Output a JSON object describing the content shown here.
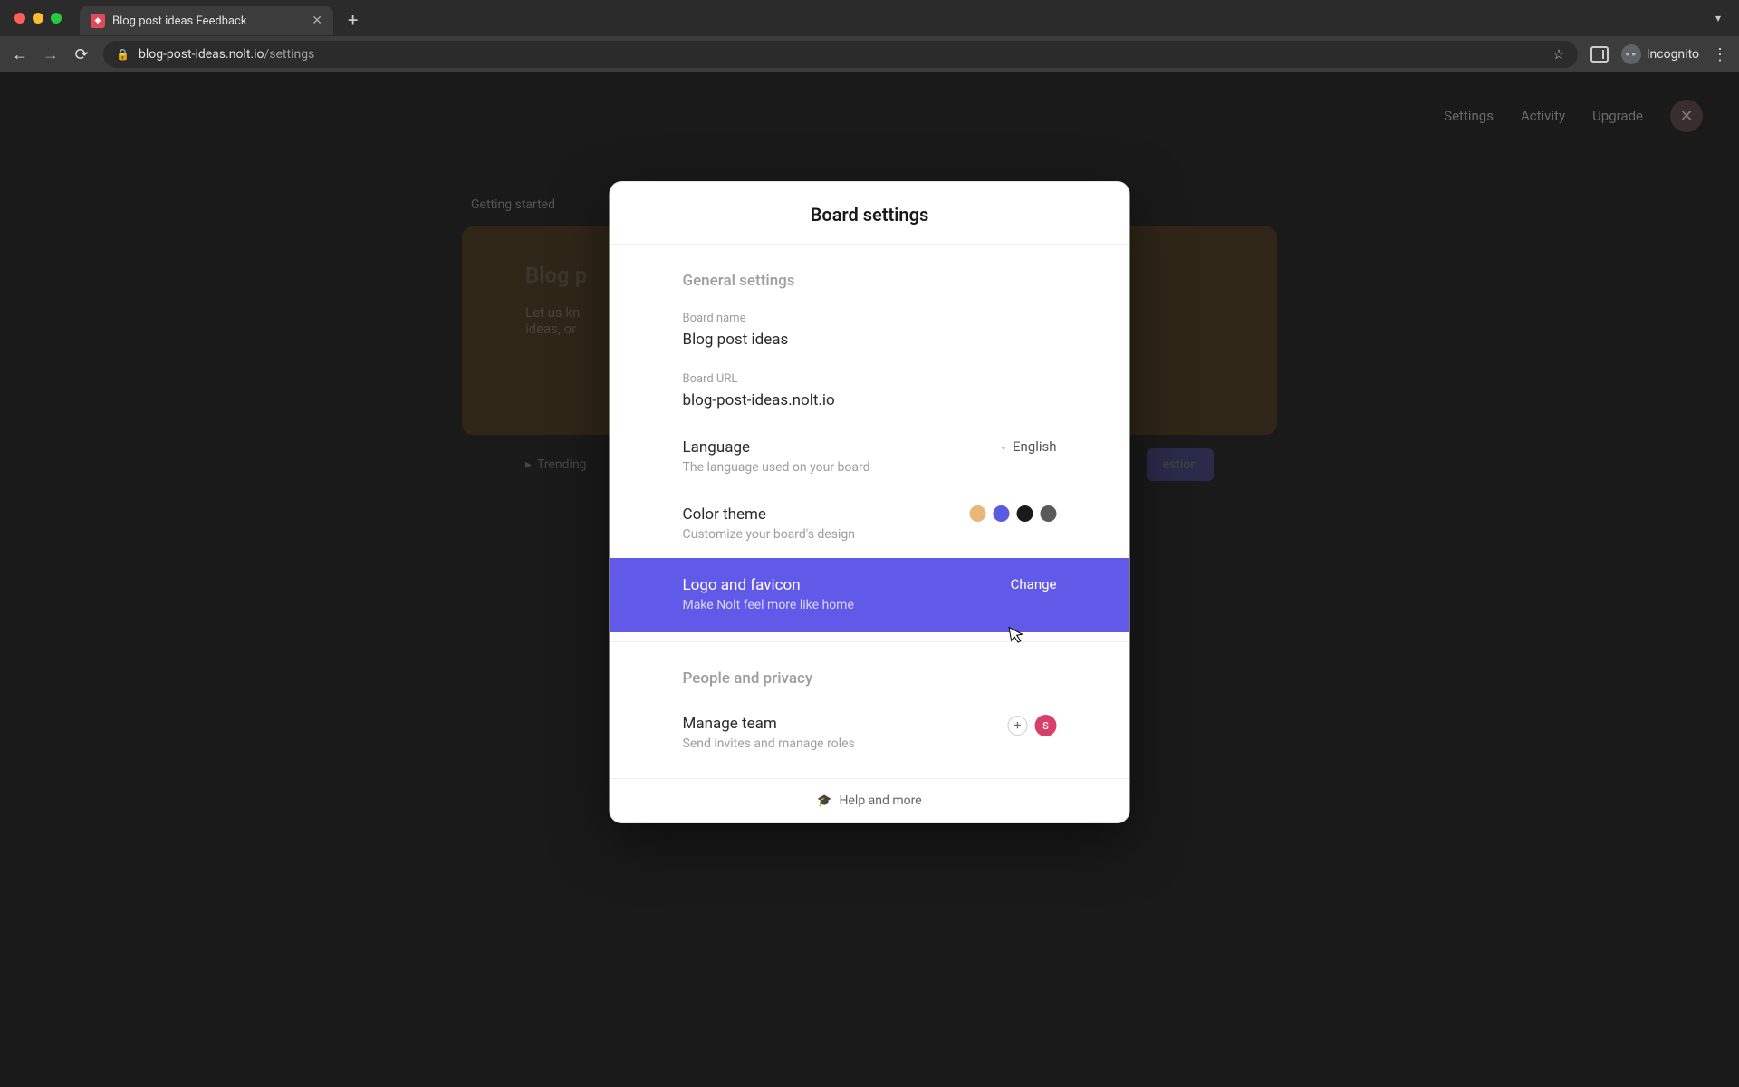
{
  "browser": {
    "tab_title": "Blog post ideas Feedback",
    "url_host": "blog-post-ideas.nolt.io",
    "url_path": "/settings",
    "incognito_label": "Incognito"
  },
  "backdrop": {
    "nav": {
      "settings": "Settings",
      "activity": "Activity",
      "upgrade": "Upgrade"
    },
    "getting_started": "Getting started",
    "card_title": "Blog p",
    "card_line1": "Let us kn",
    "card_line2": "ideas, or",
    "trending": "Trending",
    "suggestion_btn": "estion"
  },
  "modal": {
    "title": "Board settings",
    "general": {
      "section_title": "General settings",
      "board_name_label": "Board name",
      "board_name_value": "Blog post ideas",
      "board_url_label": "Board URL",
      "board_url_value": "blog-post-ideas.nolt.io",
      "language_title": "Language",
      "language_sub": "The language used on your board",
      "language_value": "English",
      "color_title": "Color theme",
      "color_sub": "Customize your board's design",
      "logo_title": "Logo and favicon",
      "logo_sub": "Make Nolt feel more like home",
      "logo_action": "Change"
    },
    "people": {
      "section_title": "People and privacy",
      "manage_title": "Manage team",
      "manage_sub": "Send invites and manage roles",
      "avatar_initial": "S"
    },
    "footer": "Help and more"
  }
}
